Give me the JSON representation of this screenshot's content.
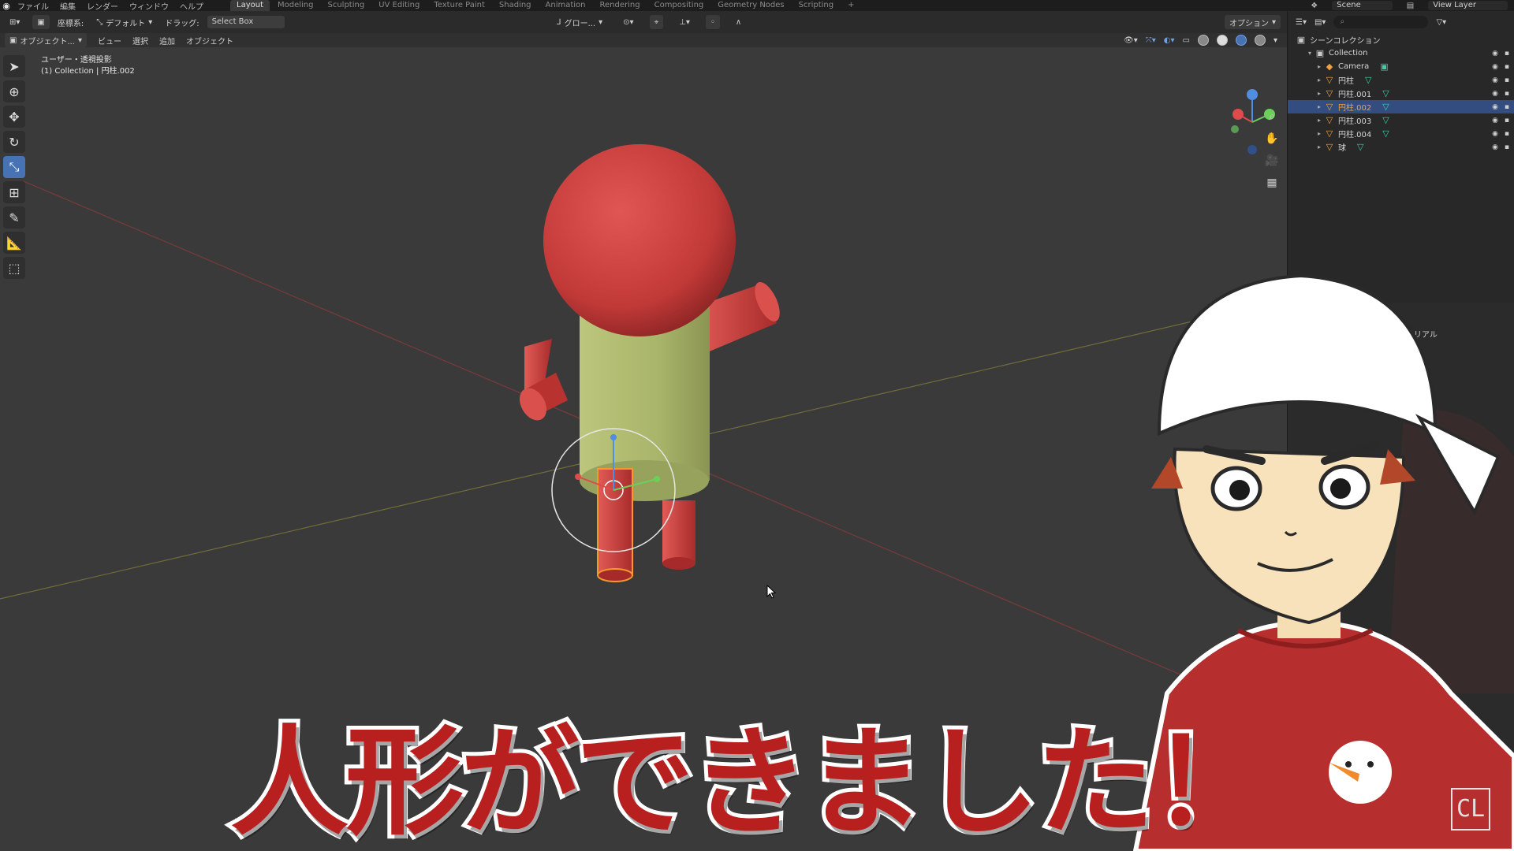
{
  "topbar": {
    "menu": [
      "ファイル",
      "編集",
      "レンダー",
      "ウィンドウ",
      "ヘルプ"
    ],
    "tabs": [
      {
        "label": "Layout",
        "active": true
      },
      {
        "label": "Modeling",
        "active": false
      },
      {
        "label": "Sculpting",
        "active": false
      },
      {
        "label": "UV Editing",
        "active": false
      },
      {
        "label": "Texture Paint",
        "active": false
      },
      {
        "label": "Shading",
        "active": false
      },
      {
        "label": "Animation",
        "active": false
      },
      {
        "label": "Rendering",
        "active": false
      },
      {
        "label": "Compositing",
        "active": false
      },
      {
        "label": "Geometry Nodes",
        "active": false
      },
      {
        "label": "Scripting",
        "active": false
      }
    ],
    "add_tab": "+",
    "scene": "Scene",
    "view_layer": "View Layer"
  },
  "header": {
    "mode_label": "座標系:",
    "orientation": "デフォルト",
    "drag_label": "ドラッグ:",
    "select_mode": "Select Box",
    "transform_orientation": "グロー...",
    "options": "オプション"
  },
  "header3": {
    "mode": "オブジェクト...",
    "menus": [
      "ビュー",
      "選択",
      "追加",
      "オブジェクト"
    ]
  },
  "viewport": {
    "view_name": "ユーザー・透視投影",
    "collection_info": "(1) Collection | 円柱.002"
  },
  "outliner": {
    "root": "シーンコレクション",
    "collection": "Collection",
    "items": [
      {
        "name": "Camera",
        "type": "camera",
        "selected": false
      },
      {
        "name": "円柱",
        "type": "mesh",
        "selected": false
      },
      {
        "name": "円柱.001",
        "type": "mesh",
        "selected": false
      },
      {
        "name": "円柱.002",
        "type": "mesh",
        "selected": true
      },
      {
        "name": "円柱.003",
        "type": "mesh",
        "selected": false
      },
      {
        "name": "円柱.004",
        "type": "mesh",
        "selected": false
      },
      {
        "name": "球",
        "type": "mesh",
        "selected": false
      }
    ]
  },
  "properties": {
    "label": "リアル"
  },
  "overlay": {
    "caption": "人形ができました！",
    "badge": "CL"
  },
  "colors": {
    "accent": "#4772b3",
    "head": "#c23a38",
    "body": "#a9b56a",
    "caption": "#b81f1f"
  }
}
